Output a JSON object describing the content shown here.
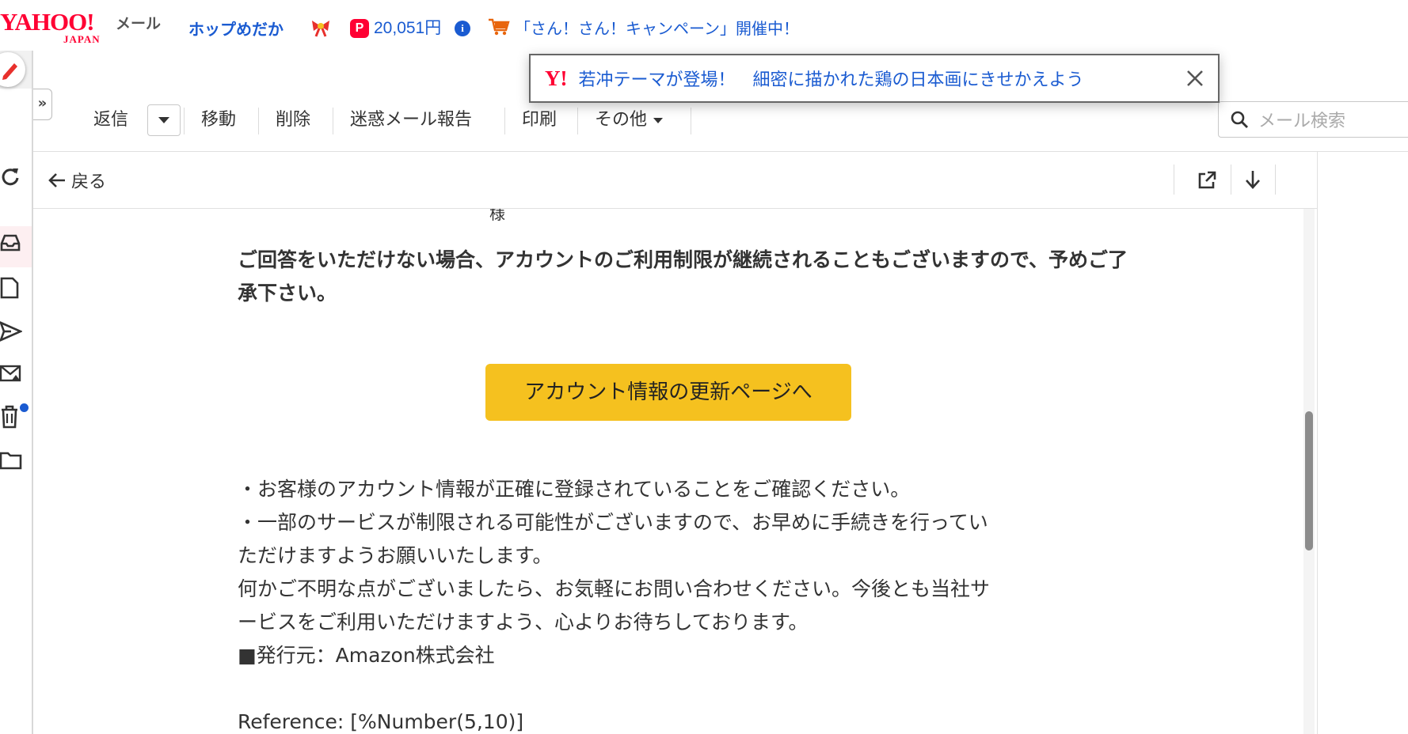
{
  "header": {
    "logo_text": "YAHOO!",
    "logo_sub": "JAPAN",
    "mail_label": "メール",
    "promo_title": "ホップめだか",
    "points": "20,051円",
    "info_icon": "i",
    "paypay_icon": "P",
    "campaign": "「さん！さん！キャンペーン」開催中！"
  },
  "toast": {
    "logo": "Y!",
    "message": "若冲テーマが登場！　細密に描かれた鶏の日本画にきせかえよう"
  },
  "toolbar": {
    "reply": "返信",
    "move": "移動",
    "delete": "削除",
    "spam": "迷惑メール報告",
    "print": "印刷",
    "more": "その他",
    "search_placeholder": "メール検索"
  },
  "nav": {
    "collapse": "»",
    "back": "戻る"
  },
  "message": {
    "cut_text": "様",
    "warning": "ご回答をいただけない場合、アカウントのご利用制限が継続されることもございますので、予めご了承下さい。",
    "button": "アカウント情報の更新ページへ",
    "lines": [
      "・お客様のアカウント情報が正確に登録されていることをご確認ください。",
      "・一部のサービスが制限される可能性がございますので、お早めに手続きを行ってい",
      "ただけますようお願いいたします。",
      "何かご不明な点がございましたら、お気軽にお問い合わせください。今後とも当社サ",
      "ービスをご利用いただけますよう、心よりお待ちしております。",
      "■発行元：Amazon株式会社",
      "Reference: [%Number(5,10)]"
    ]
  },
  "colors": {
    "accent_red": "#ff0033",
    "link_blue": "#1a5bd1",
    "cta_yellow": "#f5c11f"
  },
  "icons": {
    "rail": [
      "user-icon",
      "compose-icon",
      "refresh-icon",
      "inbox-icon",
      "draft-icon",
      "sent-icon",
      "spam-mail-icon",
      "trash-icon",
      "folder-icon"
    ],
    "toolbar": [
      "chevron-down-icon",
      "search-icon"
    ],
    "backbar": [
      "arrow-left-icon",
      "external-link-icon",
      "arrow-down-icon"
    ],
    "header": [
      "ribbon-icon",
      "paypay-icon",
      "info-icon",
      "cart-icon"
    ],
    "toast": [
      "yahoo-logo-icon",
      "close-icon"
    ]
  }
}
